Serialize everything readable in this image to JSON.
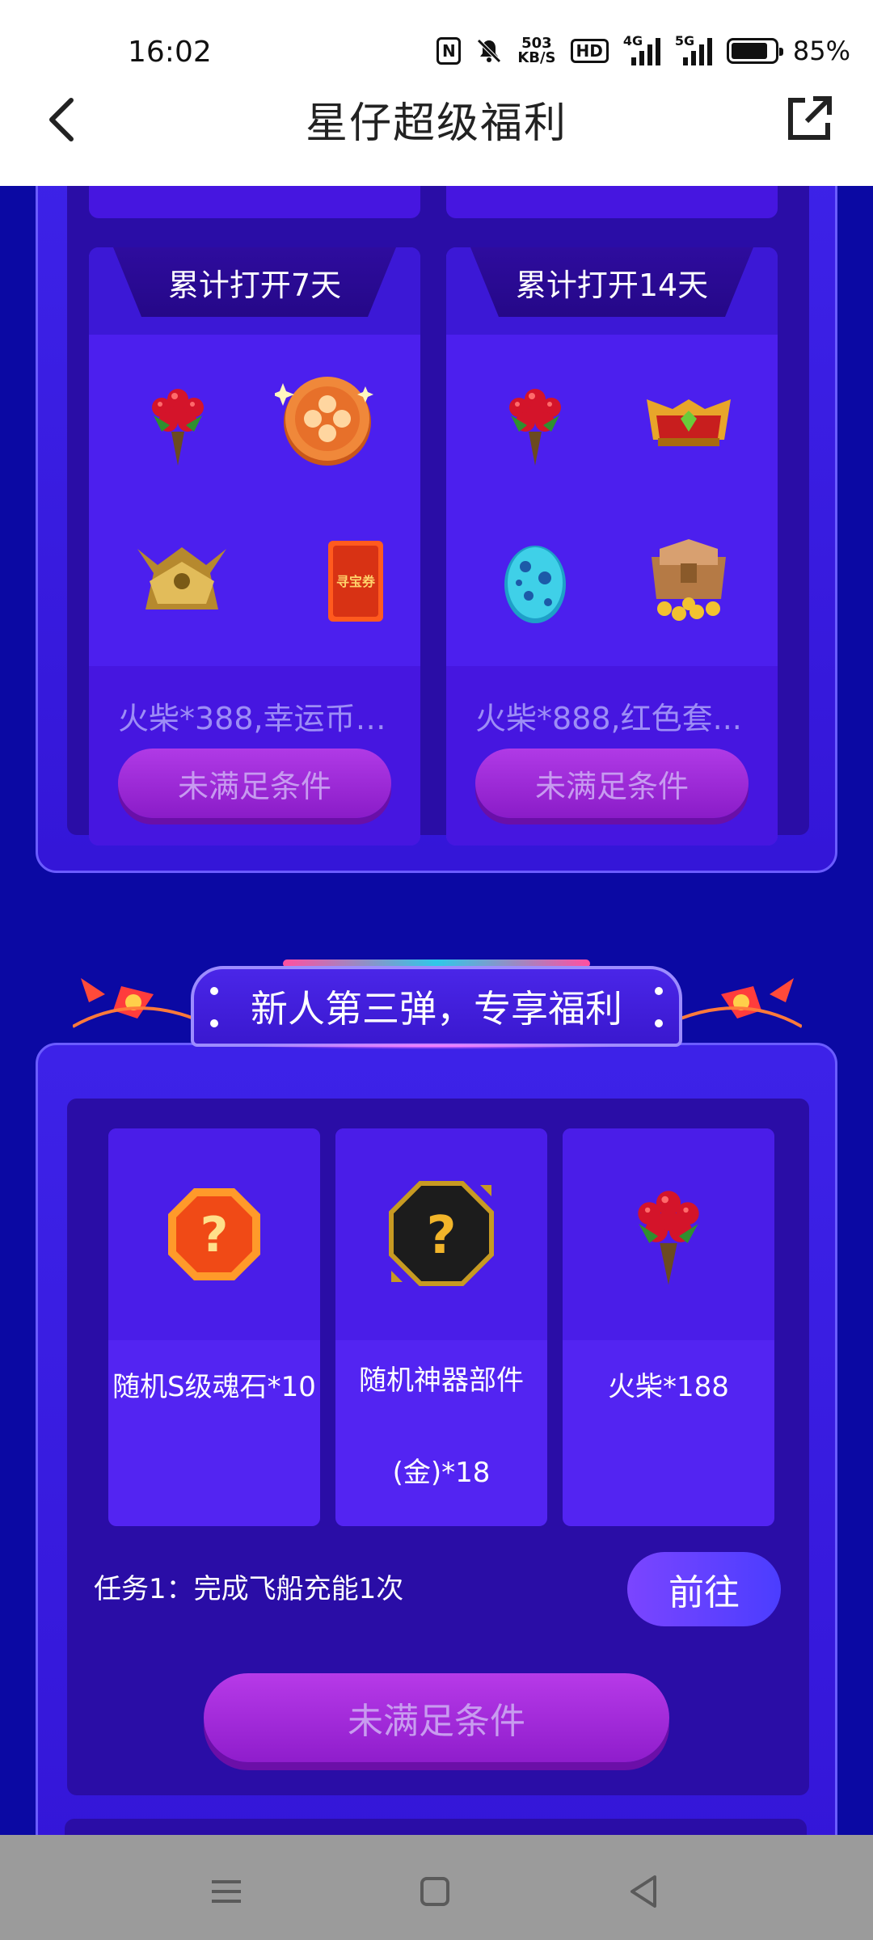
{
  "status_bar": {
    "time": "16:02",
    "network_speed_value": "503",
    "network_speed_unit": "KB/S",
    "hd_badge": "HD",
    "network_4g": "4G",
    "network_5g": "5G",
    "battery_percent": "85%",
    "battery_level": 0.85
  },
  "header": {
    "title": "星仔超级福利"
  },
  "section1": {
    "cards": [
      {
        "tag": "累计打开7天",
        "description": "火柴*388,幸运币*...",
        "button_label": "未满足条件",
        "icons": [
          "flower-bouquet-icon",
          "lucky-coin-icon",
          "golden-crown-icon",
          "treasure-ticket-icon"
        ]
      },
      {
        "tag": "累计打开14天",
        "description": "火柴*888,红色套...",
        "button_label": "未满足条件",
        "icons": [
          "flower-bouquet-icon",
          "golden-helmet-icon",
          "blue-egg-icon",
          "treasure-chest-icon"
        ]
      }
    ],
    "ticket_text": "寻宝券"
  },
  "section2": {
    "banner": "新人第三弹，专享福利",
    "items": [
      {
        "label": "随机S级魂石*10",
        "icon": "orange-question-gem-icon"
      },
      {
        "label_line1": "随机神器部件",
        "label_line2": "(金)*18",
        "icon": "dark-question-gem-icon"
      },
      {
        "label": "火柴*188",
        "icon": "flower-bouquet-icon"
      }
    ],
    "task": "任务1：完成飞船充能1次",
    "go_button": "前往",
    "claim_button": "未满足条件"
  },
  "colors": {
    "page_background": "#0b09a3",
    "card_purple": "#4e21f0",
    "button_magenta": "#b03ae6"
  }
}
